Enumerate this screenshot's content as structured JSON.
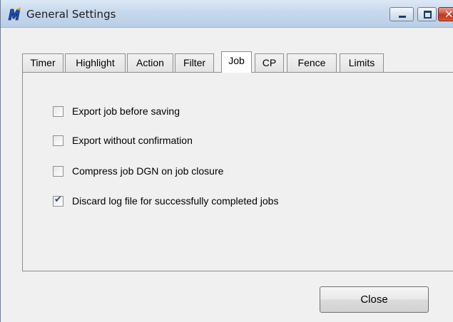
{
  "window": {
    "title": "General Settings",
    "icon": "microstation-m-icon",
    "controls": [
      "minimize-icon",
      "maximize-icon",
      "close-icon"
    ],
    "close_glyph": "✕"
  },
  "tabs": [
    {
      "label": "Timer",
      "active": false
    },
    {
      "label": "Highlight",
      "active": false
    },
    {
      "label": "Action",
      "active": false
    },
    {
      "label": "Filter",
      "active": false
    },
    {
      "label": "Job",
      "active": true
    },
    {
      "label": "CP",
      "active": false
    },
    {
      "label": "Fence",
      "active": false
    },
    {
      "label": "Limits",
      "active": false
    }
  ],
  "options": [
    {
      "label": "Export job before saving",
      "checked": false
    },
    {
      "label": "Export without confirmation",
      "checked": false
    },
    {
      "label": "Compress job DGN on job closure",
      "checked": false
    },
    {
      "label": "Discard log file for successfully completed jobs",
      "checked": true
    }
  ],
  "footer": {
    "close_label": "Close"
  },
  "colors": {
    "check": "#344d75",
    "close_control": "#c2321b",
    "app_icon": "#1f4fb0"
  }
}
